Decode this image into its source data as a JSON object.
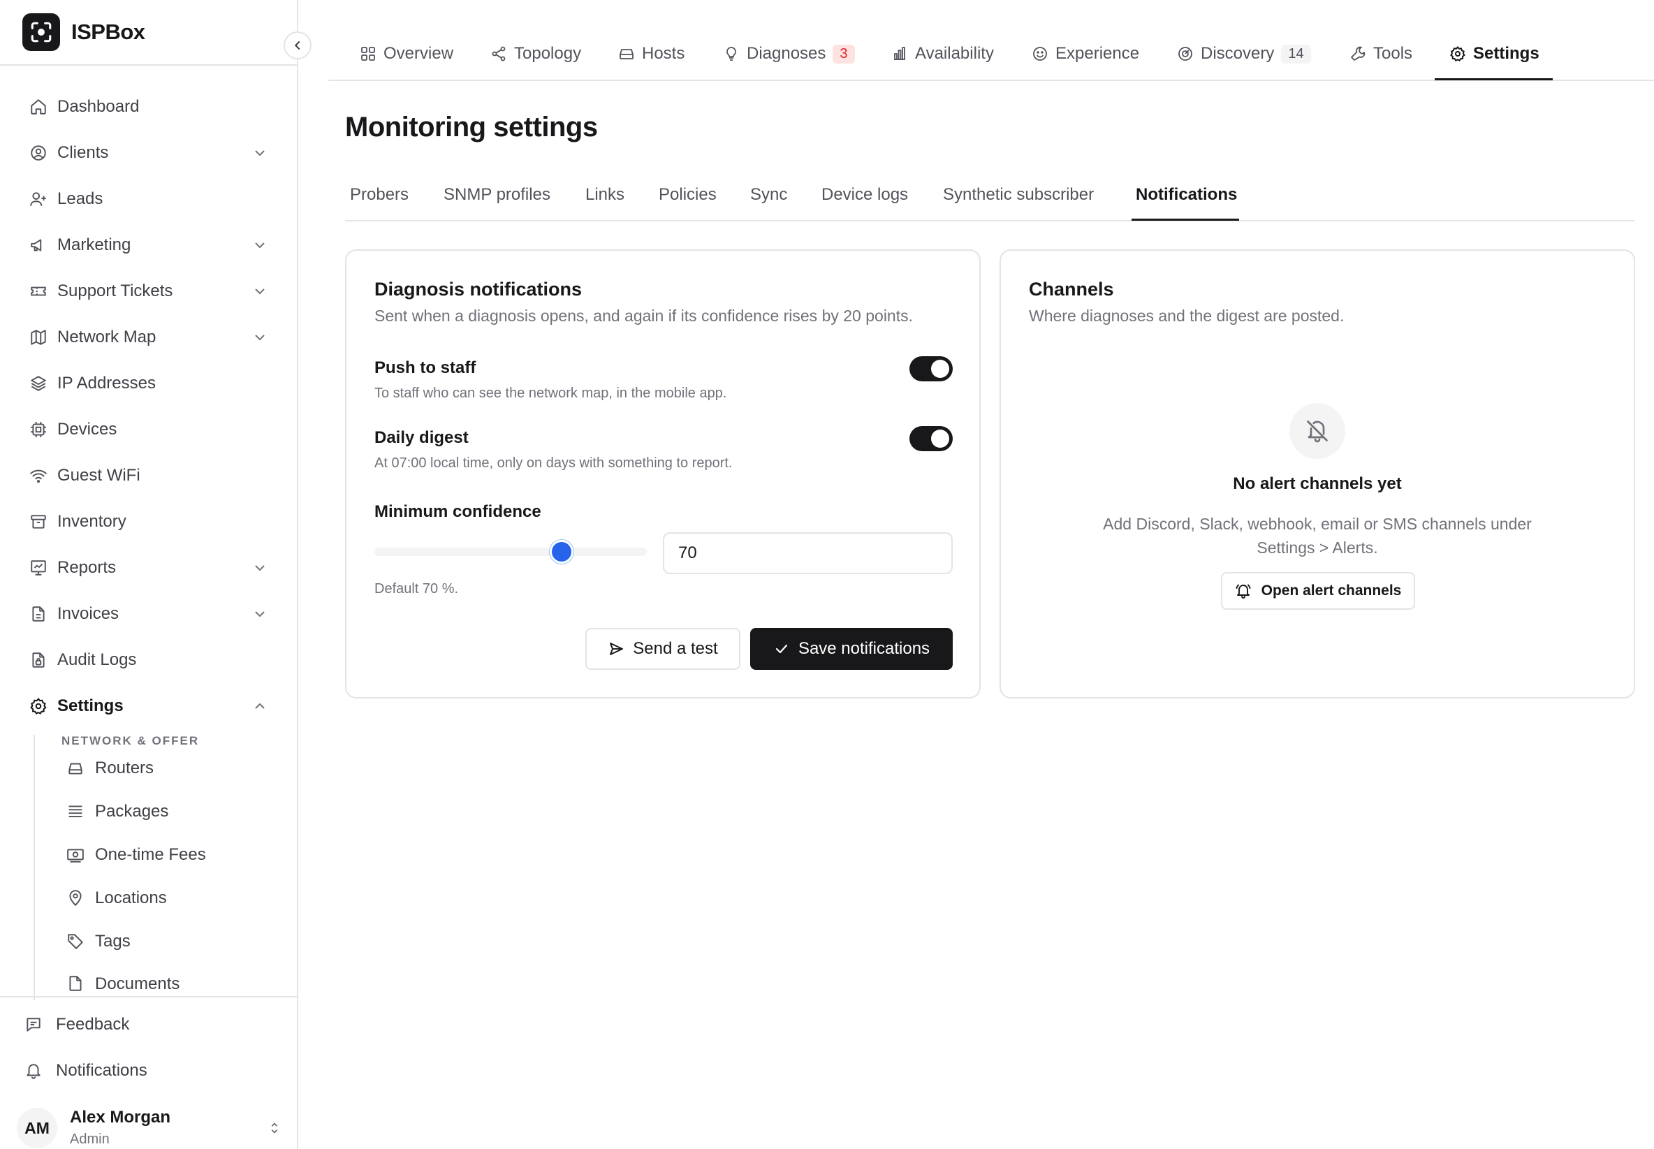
{
  "brand": {
    "name": "ISPBox"
  },
  "sidebar": {
    "items": [
      {
        "label": "Dashboard",
        "icon": "home-icon",
        "expandable": false
      },
      {
        "label": "Clients",
        "icon": "user-circle-icon",
        "expandable": true
      },
      {
        "label": "Leads",
        "icon": "user-plus-icon",
        "expandable": false
      },
      {
        "label": "Marketing",
        "icon": "megaphone-icon",
        "expandable": true
      },
      {
        "label": "Support Tickets",
        "icon": "ticket-icon",
        "expandable": true
      },
      {
        "label": "Network Map",
        "icon": "map-icon",
        "expandable": true
      },
      {
        "label": "IP Addresses",
        "icon": "layers-icon",
        "expandable": false
      },
      {
        "label": "Devices",
        "icon": "chip-icon",
        "expandable": false
      },
      {
        "label": "Guest WiFi",
        "icon": "wifi-icon",
        "expandable": false
      },
      {
        "label": "Inventory",
        "icon": "archive-icon",
        "expandable": false
      },
      {
        "label": "Reports",
        "icon": "chart-icon",
        "expandable": true
      },
      {
        "label": "Invoices",
        "icon": "file-icon",
        "expandable": true
      },
      {
        "label": "Audit Logs",
        "icon": "file-lock-icon",
        "expandable": false
      },
      {
        "label": "Settings",
        "icon": "gear-icon",
        "expandable": true,
        "expanded": true
      }
    ],
    "settings_section_label": "NETWORK & OFFER",
    "settings_sub": [
      {
        "label": "Routers",
        "icon": "router-icon"
      },
      {
        "label": "Packages",
        "icon": "stack-icon"
      },
      {
        "label": "One-time Fees",
        "icon": "banknote-icon"
      },
      {
        "label": "Locations",
        "icon": "pin-icon"
      },
      {
        "label": "Tags",
        "icon": "tag-icon"
      },
      {
        "label": "Documents",
        "icon": "document-icon"
      }
    ],
    "footer": [
      {
        "label": "Feedback",
        "icon": "feedback-icon"
      },
      {
        "label": "Notifications",
        "icon": "bell-icon"
      }
    ],
    "user": {
      "initials": "AM",
      "name": "Alex Morgan",
      "role": "Admin"
    }
  },
  "top_tabs": [
    {
      "label": "Overview",
      "icon": "grid-icon"
    },
    {
      "label": "Topology",
      "icon": "share-icon"
    },
    {
      "label": "Hosts",
      "icon": "server-icon"
    },
    {
      "label": "Diagnoses",
      "icon": "bulb-icon",
      "badge": "3",
      "badge_color": "#dc2626"
    },
    {
      "label": "Availability",
      "icon": "bar-chart-icon"
    },
    {
      "label": "Experience",
      "icon": "smile-icon"
    },
    {
      "label": "Discovery",
      "icon": "radar-icon",
      "badge": "14"
    },
    {
      "label": "Tools",
      "icon": "wrench-icon"
    },
    {
      "label": "Settings",
      "icon": "gear-icon",
      "active": true
    }
  ],
  "page": {
    "title": "Monitoring settings"
  },
  "sub_tabs": [
    {
      "label": "Probers"
    },
    {
      "label": "SNMP profiles"
    },
    {
      "label": "Links"
    },
    {
      "label": "Policies"
    },
    {
      "label": "Sync"
    },
    {
      "label": "Device logs"
    },
    {
      "label": "Synthetic subscriber"
    },
    {
      "label": "Notifications",
      "active": true
    }
  ],
  "diagnosis_card": {
    "title": "Diagnosis notifications",
    "description": "Sent when a diagnosis opens, and again if its confidence rises by 20 points.",
    "push": {
      "title": "Push to staff",
      "description": "To staff who can see the network map, in the mobile app.",
      "enabled": true
    },
    "digest": {
      "title": "Daily digest",
      "description": "At 07:00 local time, only on days with something to report.",
      "enabled": true
    },
    "confidence": {
      "label": "Minimum confidence",
      "value": "70",
      "slider_fraction": 0.7,
      "hint": "Default 70 %."
    },
    "send_test_label": "Send a test",
    "save_label": "Save notifications"
  },
  "channels_card": {
    "title": "Channels",
    "description": "Where diagnoses and the digest are posted.",
    "empty_title": "No alert channels yet",
    "empty_description": "Add Discord, Slack, webhook, email or SMS channels under Settings > Alerts.",
    "open_button_label": "Open alert channels"
  },
  "colors": {
    "accent": "#2563eb",
    "dark": "#18181b",
    "border": "#e4e4e7",
    "badge_red": "#dc2626"
  }
}
